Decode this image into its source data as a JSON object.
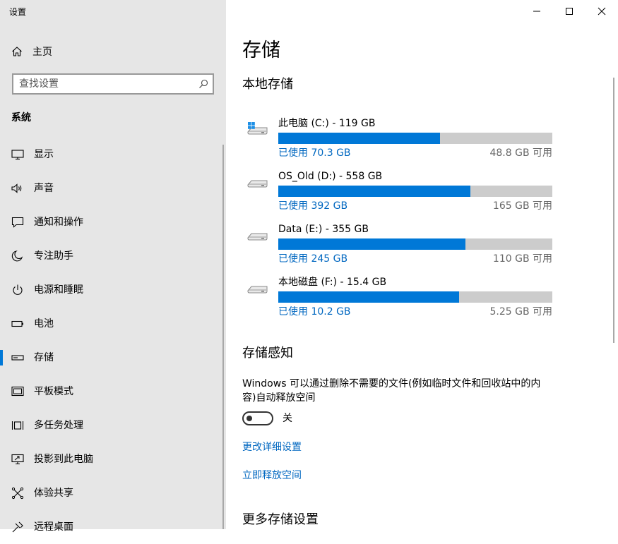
{
  "window": {
    "title": "设置"
  },
  "sidebar": {
    "home_label": "主页",
    "search_placeholder": "查找设置",
    "section": "系统",
    "items": [
      {
        "label": "显示",
        "icon": "monitor-icon"
      },
      {
        "label": "声音",
        "icon": "speaker-icon"
      },
      {
        "label": "通知和操作",
        "icon": "notification-icon"
      },
      {
        "label": "专注助手",
        "icon": "moon-icon"
      },
      {
        "label": "电源和睡眠",
        "icon": "power-icon"
      },
      {
        "label": "电池",
        "icon": "battery-icon"
      },
      {
        "label": "存储",
        "icon": "storage-icon",
        "active": true
      },
      {
        "label": "平板模式",
        "icon": "tablet-icon"
      },
      {
        "label": "多任务处理",
        "icon": "multitask-icon"
      },
      {
        "label": "投影到此电脑",
        "icon": "project-icon"
      },
      {
        "label": "体验共享",
        "icon": "share-icon"
      },
      {
        "label": "远程桌面",
        "icon": "remote-desktop-icon"
      }
    ]
  },
  "main": {
    "title": "存储",
    "local_storage_heading": "本地存储",
    "drives": [
      {
        "name": "此电脑 (C:) - 119 GB",
        "used": "已使用 70.3 GB",
        "free": "48.8 GB 可用",
        "used_fraction": 0.59,
        "system": true
      },
      {
        "name": "OS_Old (D:) - 558 GB",
        "used": "已使用 392 GB",
        "free": "165 GB 可用",
        "used_fraction": 0.702,
        "system": false
      },
      {
        "name": "Data (E:) - 355 GB",
        "used": "已使用 245 GB",
        "free": "110 GB 可用",
        "used_fraction": 0.682,
        "system": false
      },
      {
        "name": "本地磁盘 (F:) - 15.4 GB",
        "used": "已使用 10.2 GB",
        "free": "5.25 GB 可用",
        "used_fraction": 0.661,
        "system": false
      }
    ],
    "storage_sense_heading": "存储感知",
    "storage_sense_desc": "Windows 可以通过删除不需要的文件(例如临时文件和回收站中的内容)自动释放空间",
    "toggle_state": "关",
    "link_change": "更改详细设置",
    "link_free": "立即释放空间",
    "more_heading": "更多存储设置"
  },
  "colors": {
    "accent": "#0078d7",
    "link": "#0067c0",
    "sidebar_bg": "#e6e6e6",
    "bar_track": "#cccccc"
  }
}
